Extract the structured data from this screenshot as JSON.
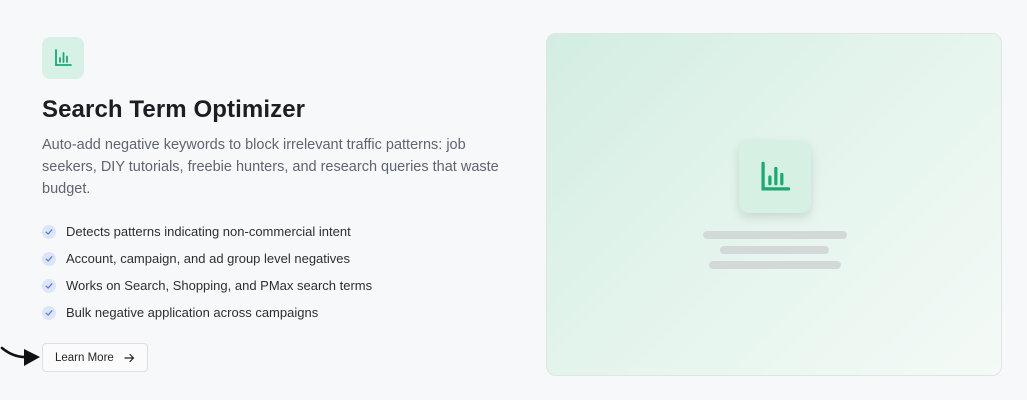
{
  "feature": {
    "icon": "bar-chart-icon",
    "title": "Search Term Optimizer",
    "description": "Auto-add negative keywords to block irrelevant traffic patterns: job seekers, DIY tutorials, freebie hunters, and research queries that waste budget.",
    "items": [
      "Detects patterns indicating non-commercial intent",
      "Account, campaign, and ad group level negatives",
      "Works on Search, Shopping, and PMax search terms",
      "Bulk negative application across campaigns"
    ],
    "cta_label": "Learn More"
  },
  "preview": {
    "icon": "bar-chart-icon"
  },
  "colors": {
    "accent": "#1aa971",
    "icon_bg": "#d7f1e6",
    "check_bg": "#dde6f8",
    "check": "#5b7fd4"
  }
}
